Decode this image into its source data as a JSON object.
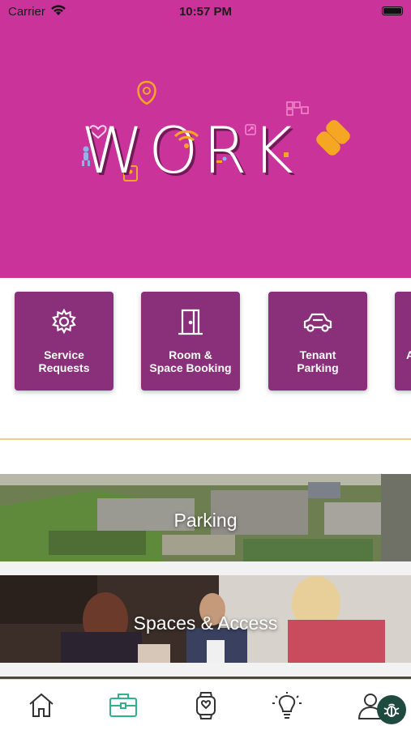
{
  "status_bar": {
    "carrier": "Carrier",
    "time": "10:57 PM"
  },
  "hero": {
    "title": "WORK"
  },
  "tiles": [
    {
      "label_line1": "Service",
      "label_line2": "Requests",
      "icon": "gear-icon"
    },
    {
      "label_line1": "Room &",
      "label_line2": "Space Booking",
      "icon": "door-icon"
    },
    {
      "label_line1": "Tenant",
      "label_line2": "Parking",
      "icon": "car-icon"
    },
    {
      "label_line1": "",
      "label_line2": "A",
      "icon": ""
    }
  ],
  "cards": [
    {
      "caption": "Parking"
    },
    {
      "caption": "Spaces & Access"
    }
  ],
  "tabbar": {
    "items": [
      "home-icon",
      "briefcase-icon",
      "watch-heart-icon",
      "lightbulb-icon",
      "user-icon"
    ],
    "active_index": 1,
    "active_color": "#2fb38a"
  },
  "colors": {
    "brand": "#c9339a",
    "tile": "#8a2f7a",
    "accent": "#2fb38a"
  }
}
